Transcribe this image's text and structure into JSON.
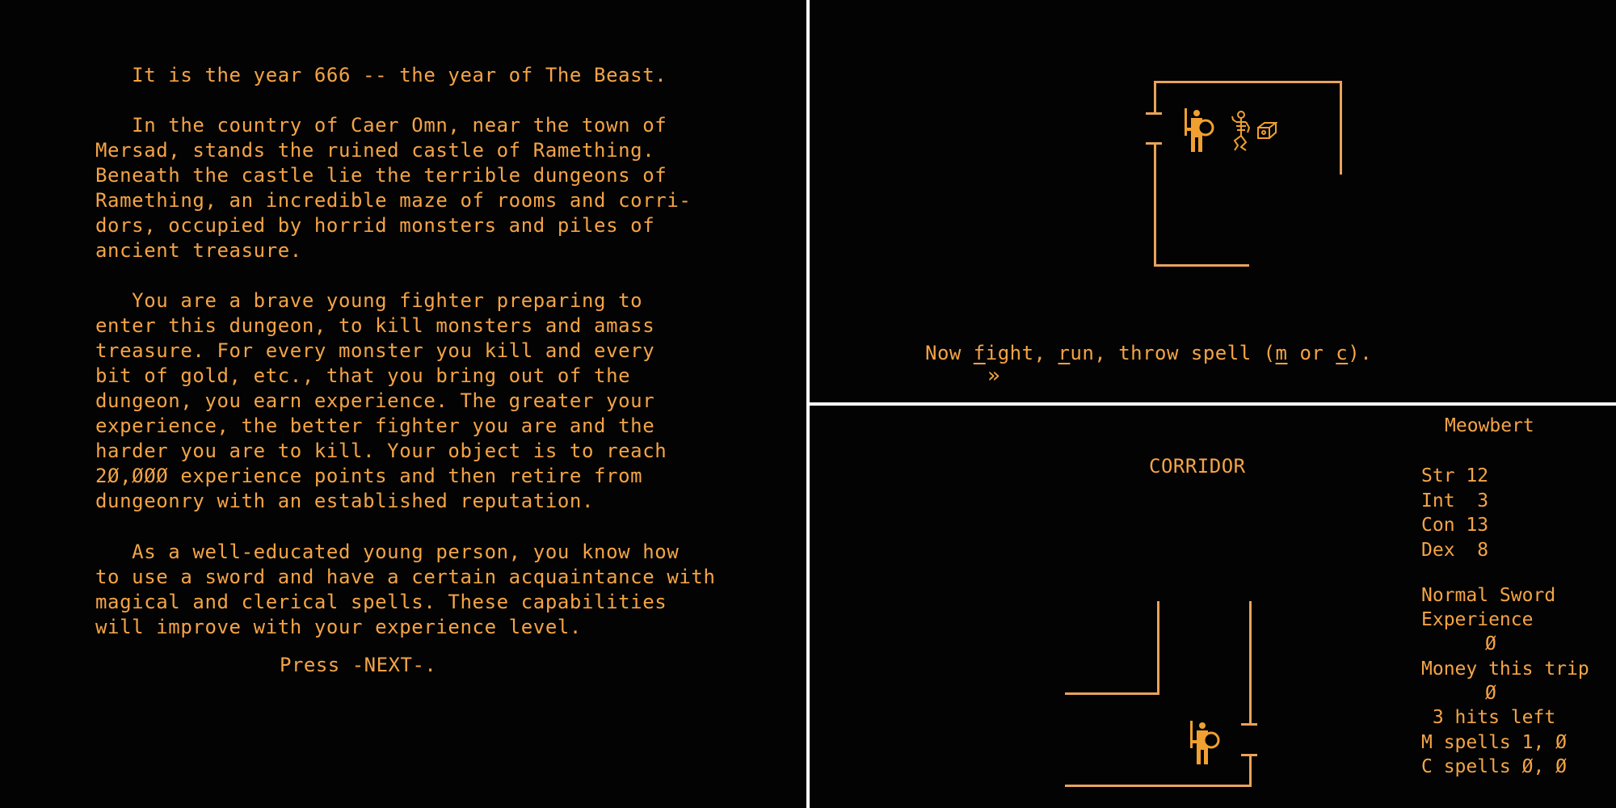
{
  "intro_screen": {
    "paragraphs": [
      [
        "   It is the year 666 -- the year of The Beast."
      ],
      [
        "   In the country of Caer Omn, near the town of",
        "Mersad, stands the ruined castle of Ramething.",
        "Beneath the castle lie the terrible dungeons of",
        "Ramething, an incredible maze of rooms and corri-",
        "dors, occupied by horrid monsters and piles of",
        "ancient treasure."
      ],
      [
        "   You are a brave young fighter preparing to",
        "enter this dungeon, to kill monsters and amass",
        "treasure. For every monster you kill and every",
        "bit of gold, etc., that you bring out of the",
        "dungeon, you earn experience. The greater your",
        "experience, the better fighter you are and the",
        "harder you are to kill. Your object is to reach",
        "2Ø,ØØØ experience points and then retire from",
        "dungeonry with an established reputation."
      ],
      [
        "   As a well-educated young person, you know how",
        "to use a sword and have a certain acquaintance with",
        "magical and clerical spells. These capabilities",
        "will improve with your experience level."
      ]
    ],
    "prompt": "Press -NEXT-."
  },
  "combat_screen": {
    "prompt_parts": {
      "now": "Now ",
      "fight_key": "f",
      "fight_rest": "ight, ",
      "run_key": "r",
      "run_rest": "un, throw spell (",
      "m_key": "m",
      "or": " or ",
      "c_key": "c",
      "end": ")."
    },
    "cursor": "»",
    "entities": [
      "fighter",
      "skeleton",
      "treasure-chest"
    ]
  },
  "explore_screen": {
    "location": "CORRIDOR",
    "character": {
      "name": "Meowbert",
      "stats": [
        {
          "label": "Str",
          "value": "12"
        },
        {
          "label": "Int",
          "value": " 3"
        },
        {
          "label": "Con",
          "value": "13"
        },
        {
          "label": "Dex",
          "value": " 8"
        }
      ],
      "weapon": "Normal Sword",
      "experience_label": "Experience",
      "experience_value": "Ø",
      "money_label": "Money this trip",
      "money_value": "Ø",
      "hits_left": " 3 hits left",
      "m_spells": "M spells 1, Ø",
      "c_spells": "C spells Ø, Ø"
    }
  },
  "colors": {
    "text": "#f4a446",
    "walls": "#e9a35b",
    "background": "#030303",
    "divider": "#ffffff"
  }
}
